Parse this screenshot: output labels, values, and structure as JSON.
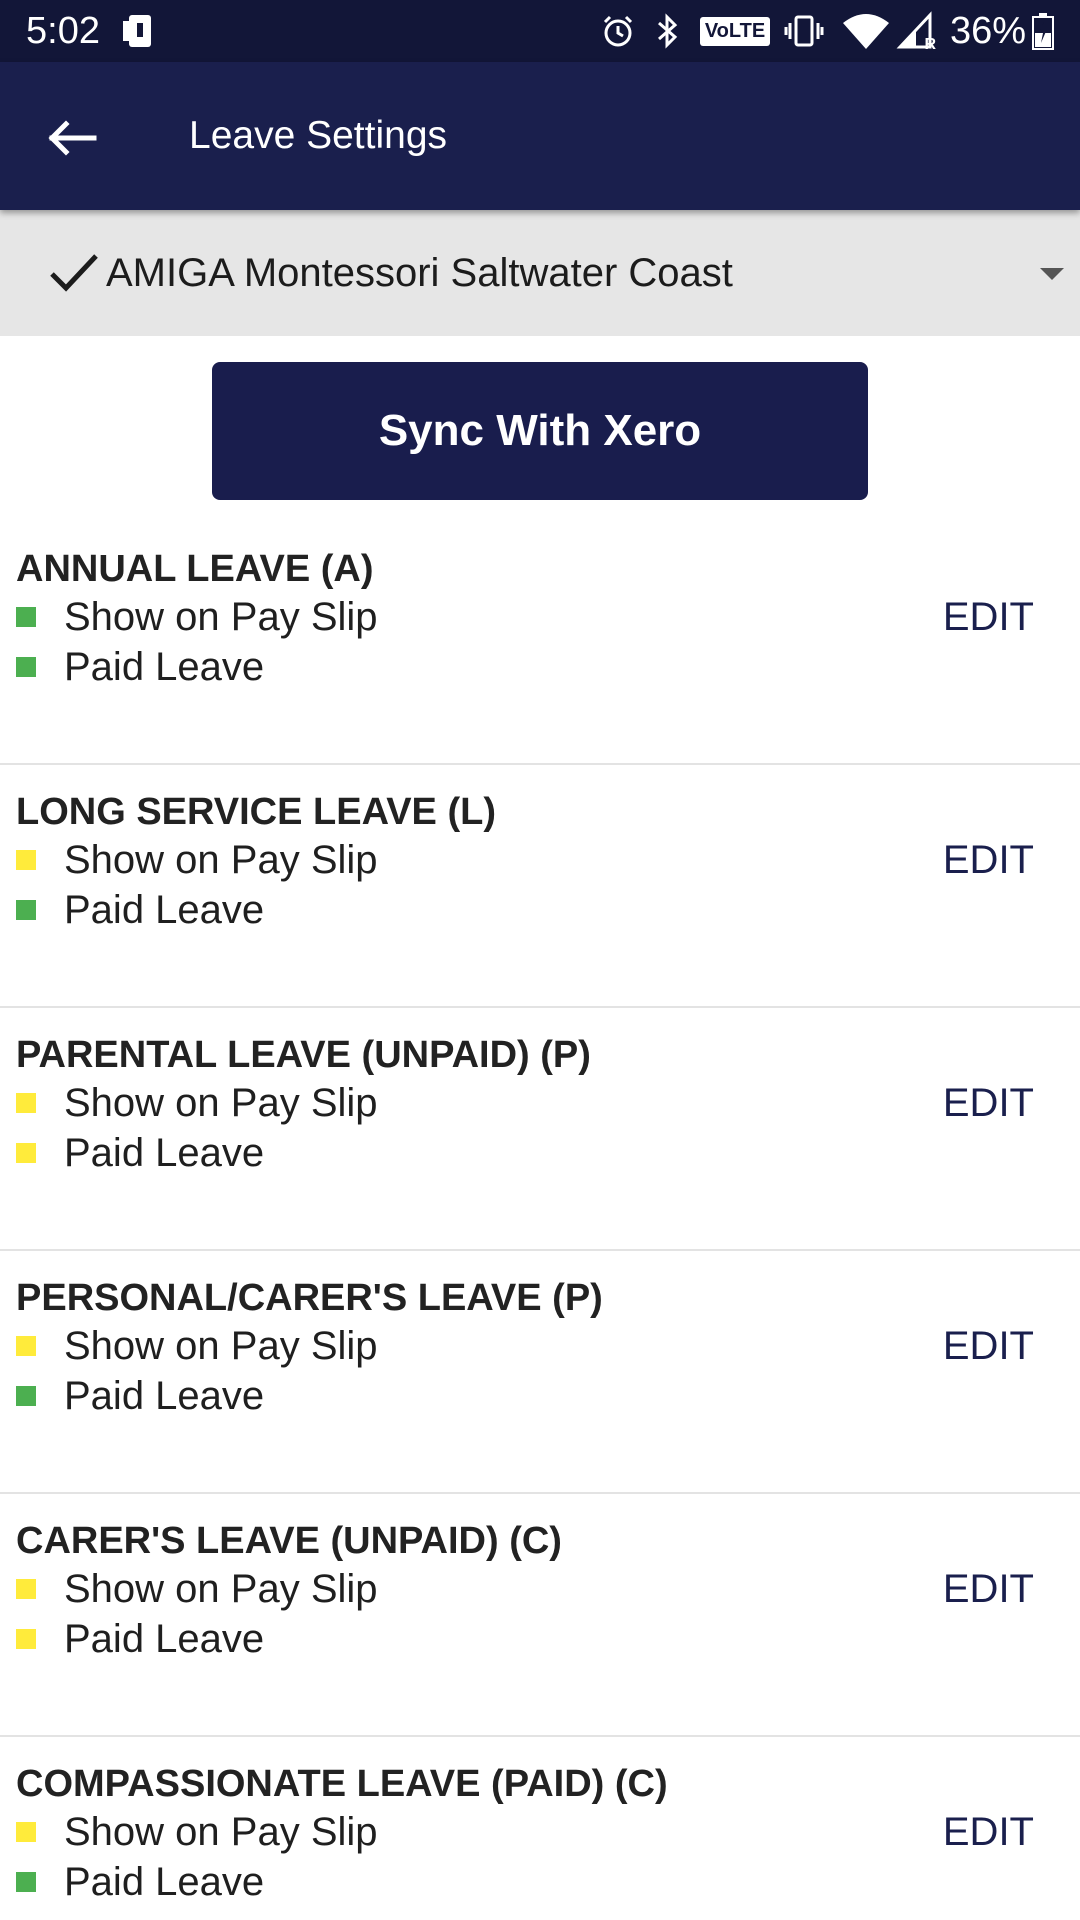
{
  "status_bar": {
    "time": "5:02",
    "battery": "36%",
    "icons": [
      "device-info-icon",
      "alarm-icon",
      "bluetooth-icon",
      "volte-icon",
      "vibrate-icon",
      "wifi-icon",
      "signal-icon",
      "battery-icon"
    ],
    "volte_label": "VoLTE",
    "roaming_label": "R"
  },
  "app_bar": {
    "title": "Leave Settings",
    "back_icon": "arrow-back-icon"
  },
  "org_selector": {
    "selected": "AMIGA Montessori Saltwater Coast",
    "check_icon": "check-icon",
    "dropdown_icon": "caret-down-icon"
  },
  "sync_button": {
    "label": "Sync With Xero"
  },
  "colors": {
    "primary": "#1a1f4d",
    "status_bar": "#121638",
    "indicator_on": "#4caf50",
    "indicator_off": "#ffeb3b"
  },
  "leave_types": [
    {
      "title": "ANNUAL LEAVE (A)",
      "show_on_pay_slip": {
        "label": "Show on Pay Slip",
        "color": "#4caf50"
      },
      "paid_leave": {
        "label": "Paid Leave",
        "color": "#4caf50"
      },
      "edit_label": "EDIT"
    },
    {
      "title": "LONG SERVICE LEAVE (L)",
      "show_on_pay_slip": {
        "label": "Show on Pay Slip",
        "color": "#ffeb3b"
      },
      "paid_leave": {
        "label": "Paid Leave",
        "color": "#4caf50"
      },
      "edit_label": "EDIT"
    },
    {
      "title": "PARENTAL LEAVE (UNPAID) (P)",
      "show_on_pay_slip": {
        "label": "Show on Pay Slip",
        "color": "#ffeb3b"
      },
      "paid_leave": {
        "label": "Paid Leave",
        "color": "#ffeb3b"
      },
      "edit_label": "EDIT"
    },
    {
      "title": "PERSONAL/CARER'S LEAVE (P)",
      "show_on_pay_slip": {
        "label": "Show on Pay Slip",
        "color": "#ffeb3b"
      },
      "paid_leave": {
        "label": "Paid Leave",
        "color": "#4caf50"
      },
      "edit_label": "EDIT"
    },
    {
      "title": "CARER'S LEAVE (UNPAID) (C)",
      "show_on_pay_slip": {
        "label": "Show on Pay Slip",
        "color": "#ffeb3b"
      },
      "paid_leave": {
        "label": "Paid Leave",
        "color": "#ffeb3b"
      },
      "edit_label": "EDIT"
    },
    {
      "title": "COMPASSIONATE LEAVE (PAID) (C)",
      "show_on_pay_slip": {
        "label": "Show on Pay Slip",
        "color": "#ffeb3b"
      },
      "paid_leave": {
        "label": "Paid Leave",
        "color": "#4caf50"
      },
      "edit_label": "EDIT"
    }
  ]
}
